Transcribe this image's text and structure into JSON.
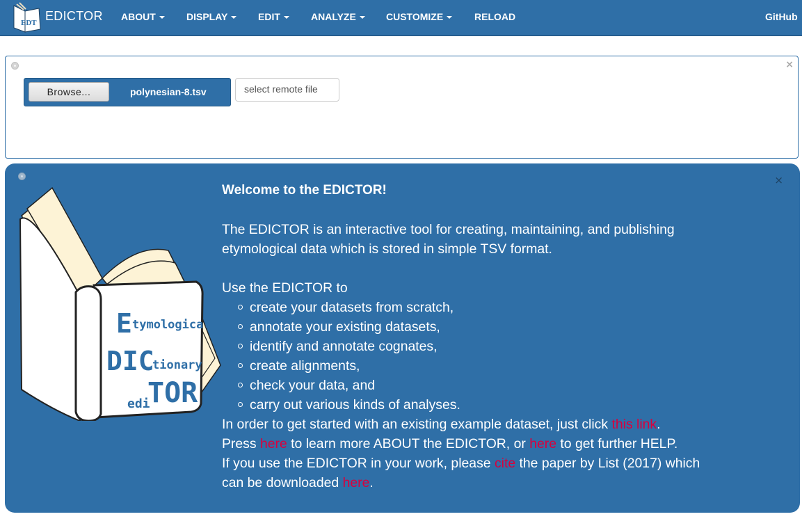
{
  "navbar": {
    "brand": "EDICTOR",
    "menus": [
      {
        "label": "ABOUT",
        "caret": true
      },
      {
        "label": "DISPLAY",
        "caret": true
      },
      {
        "label": "EDIT",
        "caret": true
      },
      {
        "label": "ANALYZE",
        "caret": true
      },
      {
        "label": "CUSTOMIZE",
        "caret": true
      },
      {
        "label": "RELOAD",
        "caret": false
      }
    ],
    "github": "GitHub",
    "logo_letters": "EDT"
  },
  "file_panel": {
    "browse_label": "Browse...",
    "file_name": "polynesian-8.tsv",
    "remote_placeholder": "select remote file",
    "close_glyph": "×"
  },
  "welcome": {
    "close_glyph": "×",
    "title": "Welcome to the EDICTOR!",
    "intro": "The EDICTOR is an interactive tool for creating, maintaining, and publishing etymological data which is stored in simple TSV format.",
    "use_heading": "Use the EDICTOR to",
    "uses": [
      "create your datasets from scratch,",
      "annotate your existing datasets,",
      "identify and annotate cognates,",
      "create alignments,",
      "check your data, and",
      "carry out various kinds of analyses."
    ],
    "line1": {
      "before": "In order to get started with an existing example dataset, just click ",
      "link": "this link",
      "after": "."
    },
    "line2": {
      "a": "Press ",
      "link1": "here",
      "b": " to learn more ABOUT the EDICTOR, or ",
      "link2": "here",
      "c": " to get further HELP."
    },
    "line3": {
      "a": "If you use the EDICTOR in your work, please ",
      "link1": "cite",
      "b": " the paper by List (2017) which can be downloaded ",
      "link2": "here",
      "c": "."
    },
    "logo_words": {
      "e": "E",
      "tymological": "tymological",
      "dic": "DIC",
      "tionary": "tionary",
      "edi": "edi",
      "tor": "TOR"
    }
  },
  "colors": {
    "primary": "#2f6fa7",
    "link": "#d9003d",
    "logo_ink": "#2f6fa7"
  }
}
